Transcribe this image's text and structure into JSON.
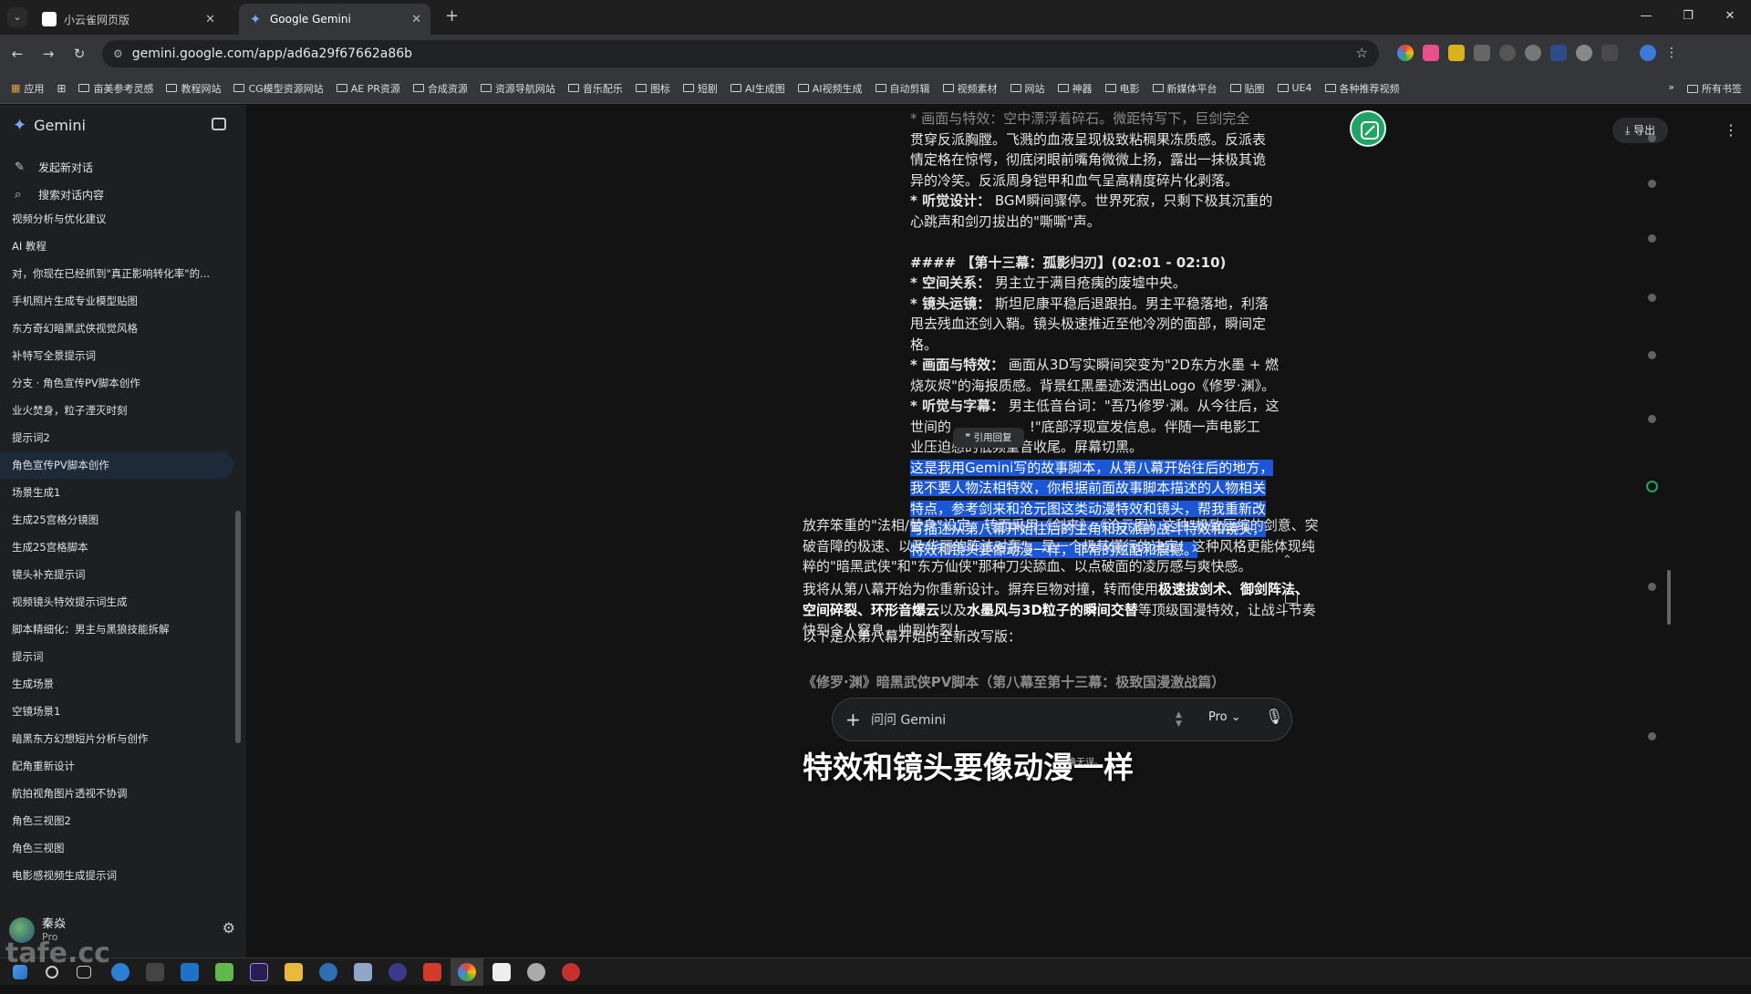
{
  "browser": {
    "tabs": [
      {
        "label": "小云雀网页版"
      },
      {
        "label": "Google Gemini"
      }
    ],
    "url": "gemini.google.com/app/ad6a29f67662a86b",
    "bookmarks": [
      "应用",
      "亩美参考灵感",
      "教程网站",
      "CG模型资源网站",
      "AE PR资源",
      "合成资源",
      "资源导航网站",
      "音乐配乐",
      "图标",
      "短剧",
      "AI生成图",
      "AI视频生成",
      "自动剪辑",
      "视频素材",
      "网站",
      "神器",
      "电影",
      "新媒体平台",
      "贴图",
      "UE4",
      "各种推荐视频"
    ],
    "all_bookmarks": "所有书签",
    "more": "»"
  },
  "sidebar": {
    "brand": "Gemini",
    "new_chat": "发起新对话",
    "search": "搜索对话内容",
    "conversations": [
      "视频分析与优化建议",
      "AI 教程",
      "对，你现在已经抓到\"真正影响转化率\"的...",
      "手机照片生成专业模型贴图",
      "东方奇幻暗黑武侠视觉风格",
      "补特写全景提示词",
      "分支 · 角色宣传PV脚本创作",
      "业火焚身，粒子湮灭时刻",
      "提示词2",
      "角色宣传PV脚本创作",
      "场景生成1",
      "生成25宫格分镜图",
      "生成25宫格脚本",
      "镜头补充提示词",
      "视频镜头特效提示词生成",
      "脚本精细化：男主与黑狼技能拆解",
      "提示词",
      "生成场景",
      "空镜场景1",
      "暗黑东方幻想短片分析与创作",
      "配角重新设计",
      "航拍视角图片透视不协调",
      "角色三视图2",
      "角色三视图",
      "电影感视频生成提示词"
    ],
    "user": {
      "name": "秦焱",
      "plan": "Pro"
    }
  },
  "main": {
    "export_label": "导出",
    "user_message": {
      "line1": "* 画面与特效：空中漂浮着碎石。微距特写下，巨剑完全",
      "line2": "贯穿反派胸膛。飞溅的血液呈现极致粘稠果冻质感。反派表",
      "line3": "情定格在惊愕，彻底闭眼前嘴角微微上扬，露出一抹极其诡",
      "line4": "异的冷笑。反派周身铠甲和血气呈高精度碎片化剥落。",
      "line5_b": "* 听觉设计：",
      "line5_t": "BGM瞬间骤停。世界死寂，只剩下极其沉重的",
      "line6": "心跳声和剑刃拔出的\"嘶嘶\"声。",
      "heading": "#### 【第十三幕：孤影归刃】(02:01 - 02:10)",
      "space_b": "* 空间关系：",
      "space_t": "男主立于满目疮痍的废墟中央。",
      "cam_b": "* 镜头运镜：",
      "cam_t1": "斯坦尼康平稳后退跟拍。男主平稳落地，利落",
      "cam_t2": "甩去残血还剑入鞘。镜头极速推近至他冷冽的面部，瞬间定",
      "cam_t3": "格。",
      "fx_b": "* 画面与特效：",
      "fx_t1": "画面从3D写实瞬间突变为\"2D东方水墨 + 燃",
      "fx_t2": "烧灰烬\"的海报质感。背景红黑墨迹泼洒出Logo《修罗·渊》。",
      "sub_b": "* 听觉与字幕：",
      "sub_t1": "男主低音台词：\"吾乃修罗·渊。从今往后，这",
      "sub_t2": "世间的                  !\"底部浮现宣发信息。伴随一声电影工",
      "sub_t3": "业压迫感的低频重音收尾。屏幕切黑。",
      "sel1": "这是我用Gemini写的故事脚本，从第八幕开始往后的地方，",
      "sel2": "我不要人物法相特效，你根据前面故事脚本描述的人物相关",
      "sel3": "特点，参考剑来和沧元图这类动漫特效和镜头，帮我重新改",
      "sel4": "写描述从第八幕开始往后的主角和反派的战斗特效和镜头，",
      "sel5": "特效和镜头要像动漫一样，非常的炫酷和震撼。"
    },
    "quote_popup": "引用回复",
    "response": {
      "p1": "放弃笨重的\"法相/替身\"设定，转而采用《剑来》、《沧元图》这种\"极致压缩的剑意、突破音障的极速、以及华丽的阵法对轰\"，是一个极其懂行的决定！这种风格更能体现纯粹的\"暗黑武侠\"和\"东方仙侠\"那种刀尖舔血、以点破面的凌厉感与爽快感。",
      "p2_a": "我将从第八幕开始为你重新设计。摒弃巨物对撞，转而使用",
      "p2_b": "极速拔剑术、御剑阵法、空间碎裂、环形音爆云",
      "p2_c": "以及",
      "p2_d": "水墨风与3D粒子的瞬间交替",
      "p2_e": "等顶级国漫特效，让战斗节奏快到令人窒息，帅到炸裂！",
      "p3": "以下是从第八幕开始的全新改写版：",
      "p4": "《修罗·渊》暗黑武侠PV脚本（第八幕至第十三幕：极致国漫激战篇）"
    },
    "composer": {
      "placeholder": "问问 Gemini",
      "mode": "Pro"
    },
    "caption": "特效和镜头要像动漫一样",
    "caption_small": "确无误。"
  },
  "watermark": "tafe.cc",
  "colors": {
    "accent": "#1fa463",
    "selection": "#1a56d6",
    "brand": "#7aa7ff"
  }
}
